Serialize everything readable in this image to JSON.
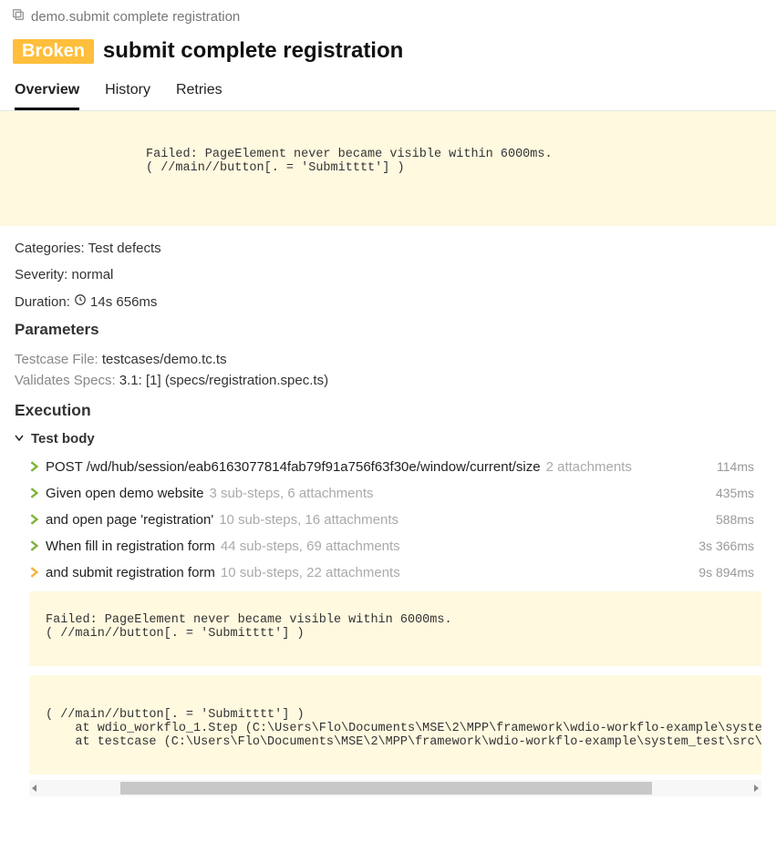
{
  "breadcrumb": "demo.submit complete registration",
  "status_badge": "Broken",
  "title": "submit complete registration",
  "tabs": {
    "overview": "Overview",
    "history": "History",
    "retries": "Retries"
  },
  "error_message": "Failed: PageElement never became visible within 6000ms.\n( //main//button[. = 'Submitttt'] )",
  "meta": {
    "categories_label": "Categories:",
    "categories_value": "Test defects",
    "severity_label": "Severity:",
    "severity_value": "normal",
    "duration_label": "Duration:",
    "duration_value": "14s 656ms"
  },
  "parameters_heading": "Parameters",
  "params": {
    "file_label": "Testcase File:",
    "file_value": "testcases/demo.tc.ts",
    "specs_label": "Validates Specs:",
    "specs_value": "3.1: [1] (specs/registration.spec.ts)"
  },
  "execution_heading": "Execution",
  "test_body_label": "Test body",
  "steps": [
    {
      "color": "green",
      "text": "POST /wd/hub/session/eab6163077814fab79f91a756f63f30e/window/current/size",
      "sub": "2 attachments",
      "time": "114ms"
    },
    {
      "color": "green",
      "text": "Given open demo website",
      "sub": "3 sub-steps, 6 attachments",
      "time": "435ms"
    },
    {
      "color": "green",
      "text": "and open page 'registration'",
      "sub": "10 sub-steps, 16 attachments",
      "time": "588ms"
    },
    {
      "color": "green",
      "text": "When fill in registration form",
      "sub": "44 sub-steps, 69 attachments",
      "time": "3s 366ms"
    },
    {
      "color": "orange",
      "text": "and submit registration form",
      "sub": "10 sub-steps, 22 attachments",
      "time": "9s 894ms"
    }
  ],
  "trace1": "Failed: PageElement never became visible within 6000ms.\n( //main//button[. = 'Submitttt'] )",
  "trace2": "( //main//button[. = 'Submitttt'] )\n    at wdio_workflo_1.Step (C:\\Users\\Flo\\Documents\\MSE\\2\\MPP\\framework\\wdio-workflo-example\\system_test\\s\n    at testcase (C:\\Users\\Flo\\Documents\\MSE\\2\\MPP\\framework\\wdio-workflo-example\\system_test\\src\\testcase"
}
